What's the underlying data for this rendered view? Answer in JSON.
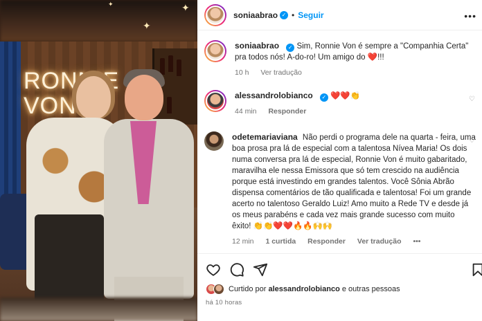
{
  "photo": {
    "neon_sign_line1": "RONNIE",
    "neon_sign_line2": "VON"
  },
  "header": {
    "username": "soniaabrao",
    "separator": "•",
    "follow_label": "Seguir",
    "more_icon": "more-horizontal-icon"
  },
  "comments": [
    {
      "username": "soniaabrao",
      "text": "Sim, Ronnie Von é sempre a \"Companhia Certa\" pra todos nós! A-do-ro! Um amigo do ❤️!!!",
      "time": "10 h",
      "actions": [
        "Ver tradução"
      ]
    },
    {
      "username": "alessandrolobianco",
      "text": "❤️❤️👏",
      "time": "44 min",
      "actions": [
        "Responder"
      ]
    },
    {
      "username": "odetemariaviana",
      "text": "Não perdi o programa dele na quarta - feira, uma boa prosa pra lá de especial com a talentosa Nívea Maria! Os dois numa conversa pra lá de especial, Ronnie Von é muito gabaritado, maravilha ele nessa Emissora que só tem crescido na audiência porque está investindo em grandes talentos. Você Sônia Abrão dispensa comentários de tão qualificada e talentosa! Foi um grande acerto no talentoso Geraldo Luiz! Amo muito a Rede TV e desde já os meus parabéns e cada vez mais grande sucesso com muito êxito! 👏👏❤️❤️🔥🔥🙌🙌",
      "time": "12 min",
      "likes": "1 curtida",
      "actions": [
        "Responder",
        "Ver tradução"
      ],
      "more": "•••"
    }
  ],
  "liked_by": {
    "prefix": "Curtido por",
    "user": "alessandrolobianco",
    "suffix": "e outras pessoas"
  },
  "posted_time": "há 10 horas"
}
